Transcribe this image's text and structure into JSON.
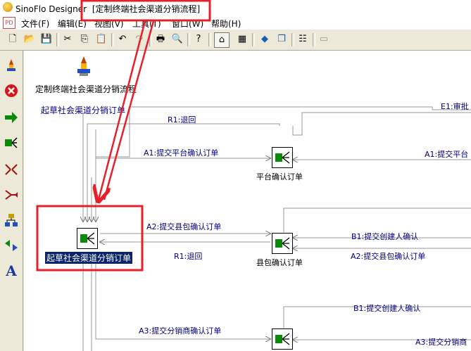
{
  "app": {
    "name": "SinoFlo Designer",
    "document_title": "[定制终端社会渠道分销流程]"
  },
  "menu": {
    "items": [
      "文件(F)",
      "编辑(E)",
      "视图(V)",
      "工具(T)",
      "窗口(W)",
      "帮助(H)"
    ]
  },
  "toolbar": {
    "buttons": [
      "new-icon",
      "open-icon",
      "save-icon",
      "cut-icon",
      "copy-icon",
      "paste-icon",
      "undo-icon",
      "redo-icon",
      "print-icon",
      "print-preview-icon",
      "help-icon",
      "home-icon",
      "grid-icon",
      "export-icon",
      "window-icon",
      "properties-icon",
      "ruler-icon"
    ]
  },
  "leftbar": {
    "tools": [
      "start-node-tool-icon",
      "end-node-tool-icon",
      "activity-tool-icon",
      "split-tool-icon",
      "join-tool-icon",
      "merge-tool-icon",
      "subflow-tool-icon",
      "route-tool-icon",
      "text-tool-icon"
    ],
    "text_tool_glyph": "A"
  },
  "canvas": {
    "process_title": "定制终端社会渠道分销流程",
    "nodes": {
      "draft_order": "起草社会渠道分销订单",
      "draft_order_top": "起草社会渠道分销订单",
      "platform_confirm": "平台确认订单",
      "county_confirm": "县包确认订单"
    },
    "flows": {
      "r1_back_top": "R1:退回",
      "e1_approve": "E1:审批",
      "a1_submit_platform": "A1:提交平台确认订单",
      "a1_submit_platform_right": "A1:提交平台",
      "a2_submit_county": "A2:提交县包确认订单",
      "r1_back_mid": "R1:退回",
      "b1_submit_creator": "B1:提交创建人确认",
      "a2_submit_county_right": "A2:提交县包确认订单",
      "b1_submit_creator_low": "B1:提交创建人确认",
      "a3_submit_distributor": "A3:提交分销商确认订单",
      "a3_submit_distributor_right": "A3:提交分销商"
    }
  },
  "colors": {
    "highlight_red": "#e5202a",
    "selection_blue": "#0a246a",
    "flow_text": "#000080"
  }
}
